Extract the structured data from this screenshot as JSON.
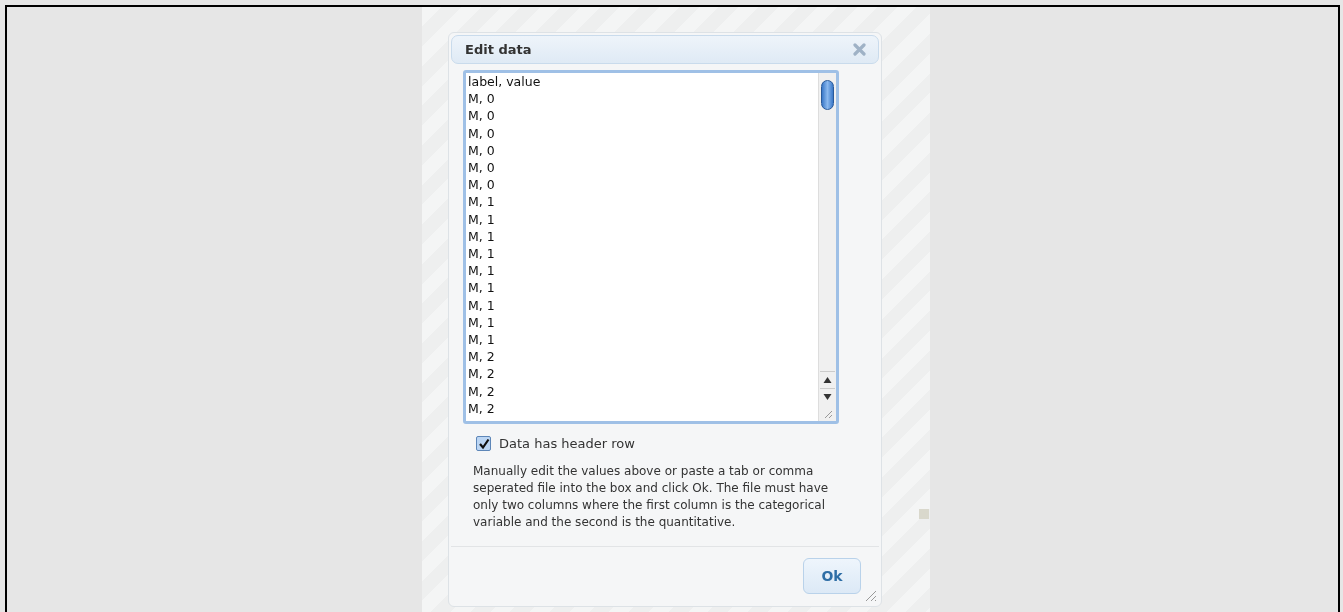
{
  "dialog": {
    "title": "Edit data",
    "data_lines": [
      "label, value",
      "M, 0",
      "M, 0",
      "M, 0",
      "M, 0",
      "M, 0",
      "M, 0",
      "M, 1",
      "M, 1",
      "M, 1",
      "M, 1",
      "M, 1",
      "M, 1",
      "M, 1",
      "M, 1",
      "M, 1",
      "M, 2",
      "M, 2",
      "M, 2",
      "M, 2"
    ],
    "header_row": {
      "label": "Data has header row",
      "checked": true
    },
    "instructions": "Manually edit the values above or paste a tab or comma seperated file into the box and click Ok. The file must have only two columns where the first column is the categorical variable and the second is the quantitative.",
    "ok_button": "Ok"
  }
}
